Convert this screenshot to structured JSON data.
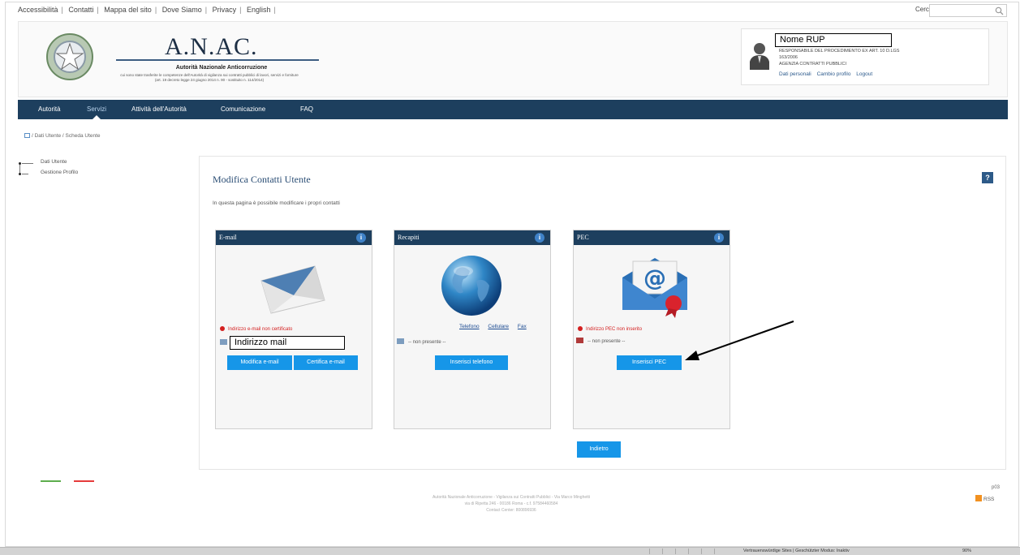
{
  "toplinks": {
    "items": [
      "Accessibilità",
      "Contatti",
      "Mappa del sito",
      "Dove Siamo",
      "Privacy",
      "English"
    ],
    "separator": "|"
  },
  "search": {
    "label": "Cerca",
    "value": "",
    "icon": "magnifier-icon"
  },
  "header": {
    "title": "A.N.AC.",
    "subtitle": "Autorità Nazionale Anticorruzione",
    "desc_line1": "cui sono state trasferite le competenze dell'Autorità di vigilanza sui contratti pubblici di lavori, servizi e forniture",
    "desc_line2": "(art. 19 decreto legge 24 giugno 2014 n. 90 - sostituito n. 114/2014)"
  },
  "user": {
    "name": "Nome RUP",
    "role_line1": "RESPONSABILE DEL PROCEDIMENTO EX ART. 10 D.LGS",
    "role_line2": "163/2006",
    "agency": "AGENZIA CONTRATTI PUBBLICI",
    "links": [
      "Dati personali",
      "Cambio profilo",
      "Logout"
    ]
  },
  "nav": {
    "items": [
      "Autorità",
      "Servizi",
      "Attività dell'Autorità",
      "Comunicazione",
      "FAQ"
    ],
    "active": "Servizi"
  },
  "breadcrumb": "/ Dati Utente / Scheda Utente",
  "tree": {
    "items": [
      "Dati Utente",
      "Gestione Profilo"
    ]
  },
  "main": {
    "title": "Modifica Contatti Utente",
    "description": "In questa pagina è possibile modificare i propri contatti",
    "help": "?",
    "back_label": "Indietro"
  },
  "cards": {
    "email": {
      "title": "E-mail",
      "info": "i",
      "warning": "Indirizzo e-mail non certificato",
      "field": "Indirizzo mail",
      "buttons": [
        "Modifica e-mail",
        "Certifica e-mail"
      ]
    },
    "recapiti": {
      "title": "Recapiti",
      "info": "i",
      "links": [
        "Telefono",
        "Cellulare",
        "Fax"
      ],
      "status": "-- non presente --",
      "button": "Inserisci telefono"
    },
    "pec": {
      "title": "PEC",
      "info": "i",
      "warning": "Indirizzo PEC non inserito",
      "status": "-- non presente --",
      "button": "Inserisci PEC"
    }
  },
  "footer": {
    "line1": "Autorità Nazionale Anticorruzione - Vigilanza sui Contratti Pubblici - Via Marco Minghetti",
    "line2": "via di Ripetta 246 - 00186 Roma - c.f. 97584460584",
    "line3": "Contact Center: 800896936",
    "code": "p03",
    "rss": "RSS"
  },
  "statusbar": {
    "zone": "Vertrauenswürdige Sites | Geschützter Modus: Inaktiv",
    "zoom": "90%"
  },
  "colors": {
    "nav_bg": "#1d3f5e",
    "button": "#1696e8",
    "warning": "#d42020",
    "title": "#2a4d74"
  }
}
